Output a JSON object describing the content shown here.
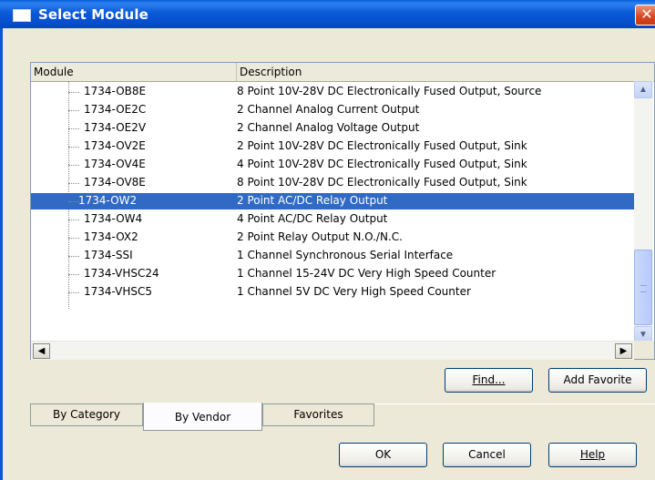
{
  "window": {
    "title": "Select Module",
    "close_glyph": "✕"
  },
  "list": {
    "columns": {
      "module": "Module",
      "description": "Description"
    },
    "rows": [
      {
        "module": "1734-OB8E",
        "description": "8 Point 10V-28V DC Electronically Fused Output, Source"
      },
      {
        "module": "1734-OE2C",
        "description": "2 Channel Analog Current Output"
      },
      {
        "module": "1734-OE2V",
        "description": "2 Channel Analog Voltage Output"
      },
      {
        "module": "1734-OV2E",
        "description": "2 Point 10V-28V DC Electronically Fused Output, Sink"
      },
      {
        "module": "1734-OV4E",
        "description": "4 Point 10V-28V DC Electronically Fused Output, Sink"
      },
      {
        "module": "1734-OV8E",
        "description": "8 Point 10V-28V DC Electronically Fused Output, Sink"
      },
      {
        "module": "1734-OW2",
        "description": "2 Point AC/DC Relay Output"
      },
      {
        "module": "1734-OW4",
        "description": "4 Point AC/DC Relay Output"
      },
      {
        "module": "1734-OX2",
        "description": "2 Point Relay Output N.O./N.C."
      },
      {
        "module": "1734-SSI",
        "description": "1 Channel Synchronous Serial Interface"
      },
      {
        "module": "1734-VHSC24",
        "description": "1 Channel 15-24V DC Very High Speed Counter"
      },
      {
        "module": "1734-VHSC5",
        "description": "1 Channel 5V DC Very High Speed Counter"
      }
    ],
    "selected_row": 6,
    "vertical_scroll_position": 0.85,
    "arrows": {
      "up": "▲",
      "down": "▼",
      "left": "◀",
      "right": "▶"
    }
  },
  "buttons": {
    "find": "Find...",
    "add_favorite": "Add Favorite",
    "ok": "OK",
    "cancel": "Cancel",
    "help": "Help"
  },
  "tabs": [
    {
      "label": "By Category"
    },
    {
      "label": "By Vendor",
      "active": true
    },
    {
      "label": "Favorites"
    }
  ],
  "colors": {
    "selection": "#316ac5",
    "title_bar": "#0b5ad6",
    "dialog_bg": "#ece9d8"
  }
}
